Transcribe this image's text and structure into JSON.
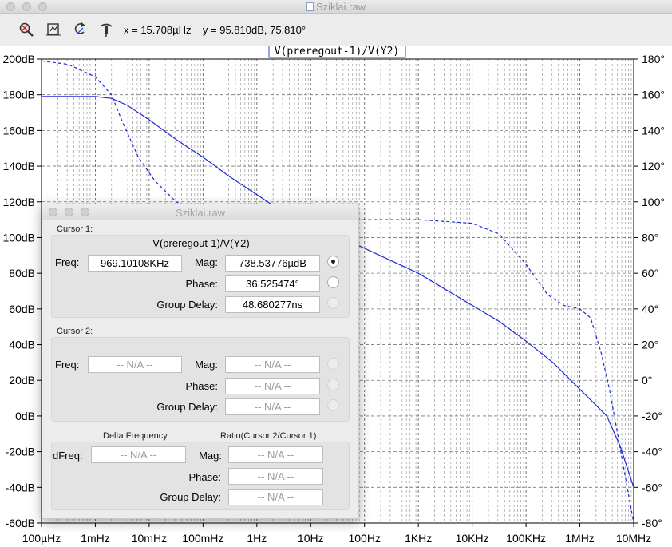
{
  "window": {
    "title": "Sziklai.raw"
  },
  "toolbar": {
    "tools": [
      {
        "name": "zoom-area-icon"
      },
      {
        "name": "zoom-extents-icon"
      },
      {
        "name": "zoom-back-icon"
      },
      {
        "name": "probe-icon"
      }
    ],
    "readout": "x = 15.708µHz    y = 95.810dB, 75.810°"
  },
  "plot": {
    "trace_label": "V(preregout-1)/V(Y2)",
    "trace_color": "#1f2bd6",
    "left_ticks": [
      "200dB",
      "180dB",
      "160dB",
      "140dB",
      "120dB",
      "100dB",
      "80dB",
      "60dB",
      "40dB",
      "20dB",
      "0dB",
      "-20dB",
      "-40dB",
      "-60dB"
    ],
    "right_ticks": [
      "180°",
      "160°",
      "140°",
      "120°",
      "100°",
      "80°",
      "60°",
      "40°",
      "20°",
      "0°",
      "-20°",
      "-40°",
      "-60°",
      "-80°"
    ],
    "x_ticks": [
      "100µHz",
      "1mHz",
      "10mHz",
      "100mHz",
      "1Hz",
      "10Hz",
      "100Hz",
      "1KHz",
      "10KHz",
      "100KHz",
      "1MHz",
      "10MHz"
    ]
  },
  "dialog": {
    "title": "Sziklai.raw",
    "cursor1": {
      "caption": "Cursor 1:",
      "expression": "V(preregout-1)/V(Y2)",
      "freq_label": "Freq:",
      "freq": "969.10108KHz",
      "mag_label": "Mag:",
      "mag": "738.53776µdB",
      "phase_label": "Phase:",
      "phase": "36.525474°",
      "gd_label": "Group Delay:",
      "gd": "48.680277ns"
    },
    "cursor2": {
      "caption": "Cursor 2:",
      "freq_label": "Freq:",
      "freq": "-- N/A --",
      "mag_label": "Mag:",
      "mag": "-- N/A --",
      "phase_label": "Phase:",
      "phase": "-- N/A --",
      "gd_label": "Group Delay:",
      "gd": "-- N/A --"
    },
    "delta": {
      "delta_header": "Delta Frequency",
      "ratio_header": "Ratio(Cursor 2/Cursor 1)",
      "dfreq_label": "dFreq:",
      "dfreq": "-- N/A --",
      "mag_label": "Mag:",
      "mag": "-- N/A --",
      "phase_label": "Phase:",
      "phase": "-- N/A --",
      "gd_label": "Group Delay:",
      "gd": "-- N/A --"
    }
  }
}
